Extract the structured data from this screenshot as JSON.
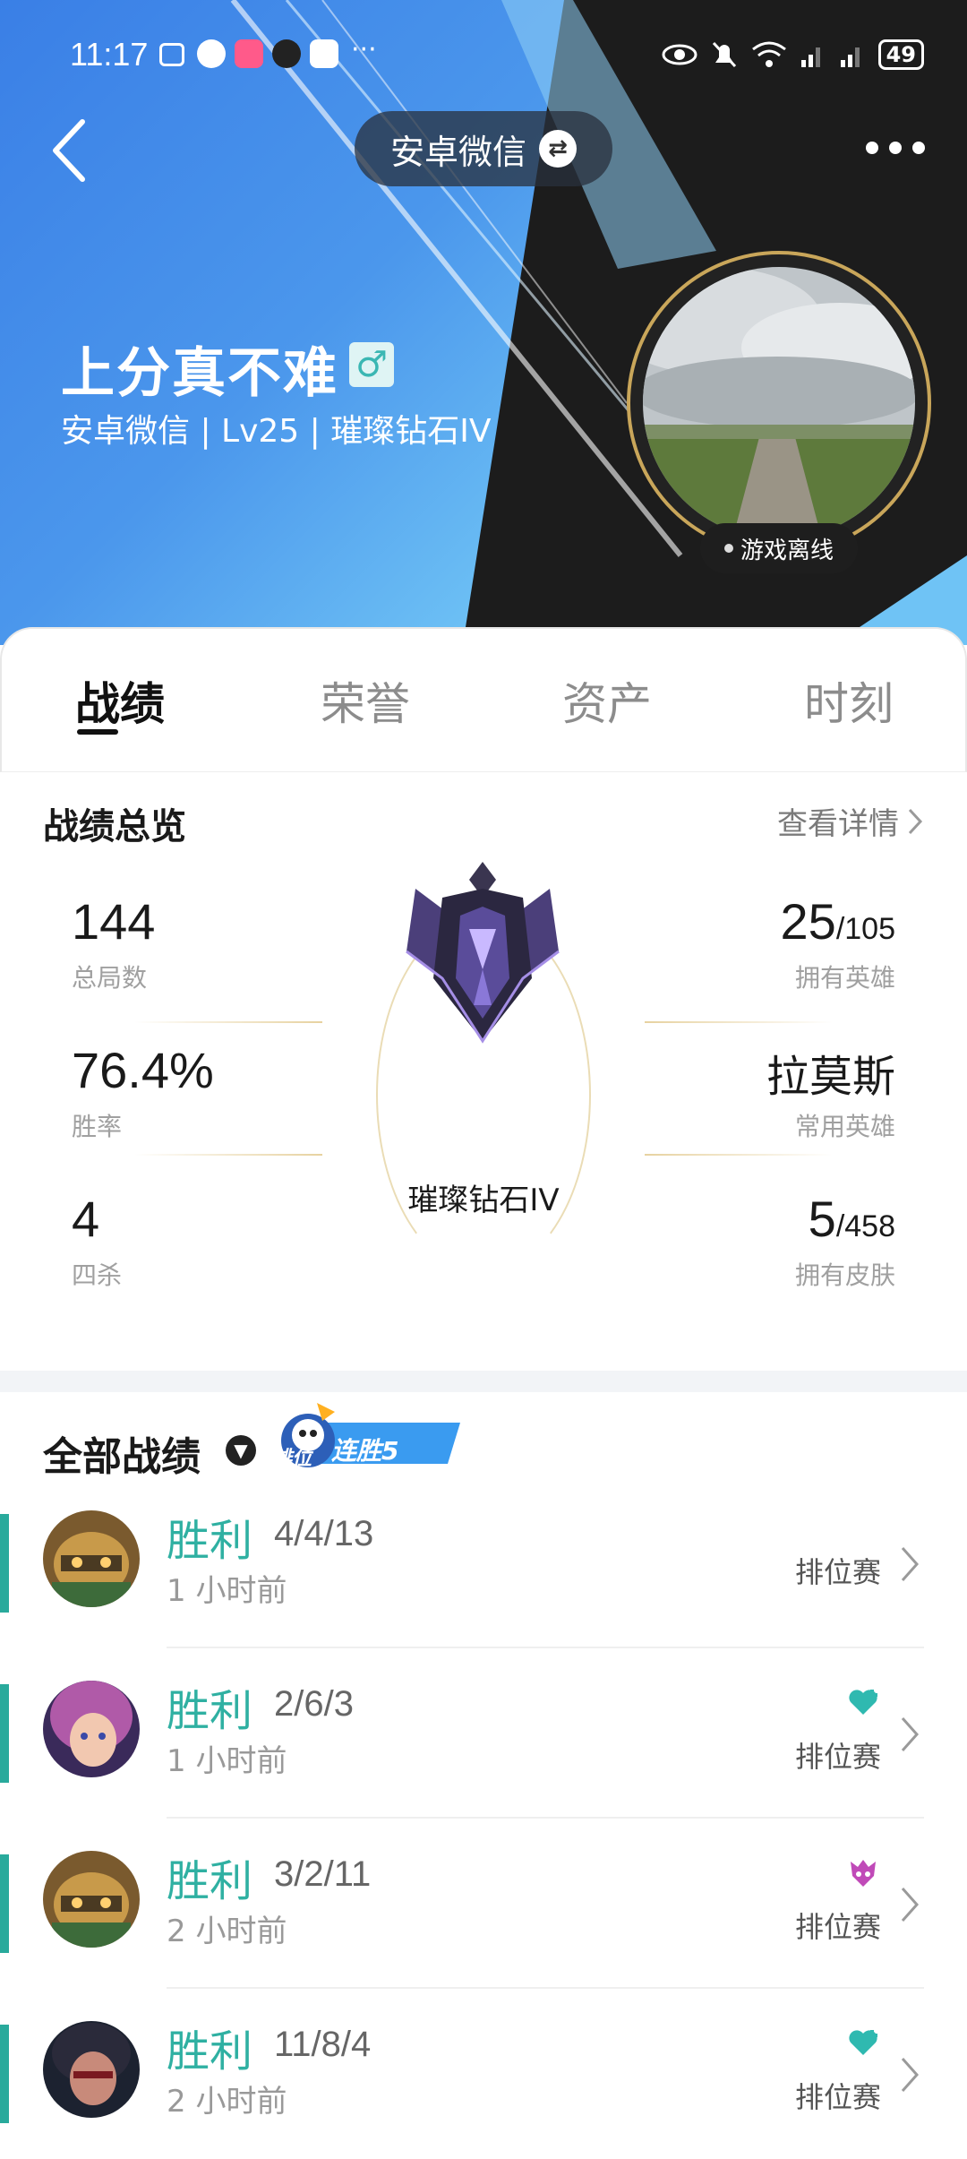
{
  "status_bar": {
    "time": "11:17",
    "dots": "···",
    "battery": "49"
  },
  "header": {
    "account_switch_label": "安卓微信",
    "player_name": "上分真不难",
    "gender_symbol": "♂",
    "subtitle": "安卓微信 | Lv25 | 璀璨钻石IV",
    "online_status": "游戏离线"
  },
  "tabs": [
    {
      "label": "战绩",
      "active": true
    },
    {
      "label": "荣誉",
      "active": false
    },
    {
      "label": "资产",
      "active": false
    },
    {
      "label": "时刻",
      "active": false
    }
  ],
  "overview": {
    "title": "战绩总览",
    "detail_link": "查看详情",
    "total_games": {
      "value": "144",
      "label": "总局数"
    },
    "win_rate": {
      "value": "76.4%",
      "label": "胜率"
    },
    "penta": {
      "value": "4",
      "label": "四杀"
    },
    "heroes_owned": {
      "value": "25",
      "total": "/105",
      "label": "拥有英雄"
    },
    "favorite_hero": {
      "value": "拉莫斯",
      "label": "常用英雄"
    },
    "skins_owned": {
      "value": "5",
      "total": "/458",
      "label": "拥有皮肤"
    },
    "rank_name": "璀璨钻石IV"
  },
  "matches_section": {
    "title": "全部战绩",
    "streak_tag_small": "排位",
    "streak_tag": "连胜5"
  },
  "matches": [
    {
      "result": "胜利",
      "kda": "4/4/13",
      "time": "1 小时前",
      "mode": "排位赛",
      "tag": ""
    },
    {
      "result": "胜利",
      "kda": "2/6/3",
      "time": "1 小时前",
      "mode": "排位赛",
      "tag": "heart-plus-icon"
    },
    {
      "result": "胜利",
      "kda": "3/2/11",
      "time": "2 小时前",
      "mode": "排位赛",
      "tag": "demon-mask-icon"
    },
    {
      "result": "胜利",
      "kda": "11/8/4",
      "time": "2 小时前",
      "mode": "排位赛",
      "tag": "heart-plus-icon"
    }
  ],
  "colors": {
    "accent_win": "#2fb0a2",
    "header_blue": "#3a7fe6",
    "rank_gold": "#c9a65a"
  }
}
